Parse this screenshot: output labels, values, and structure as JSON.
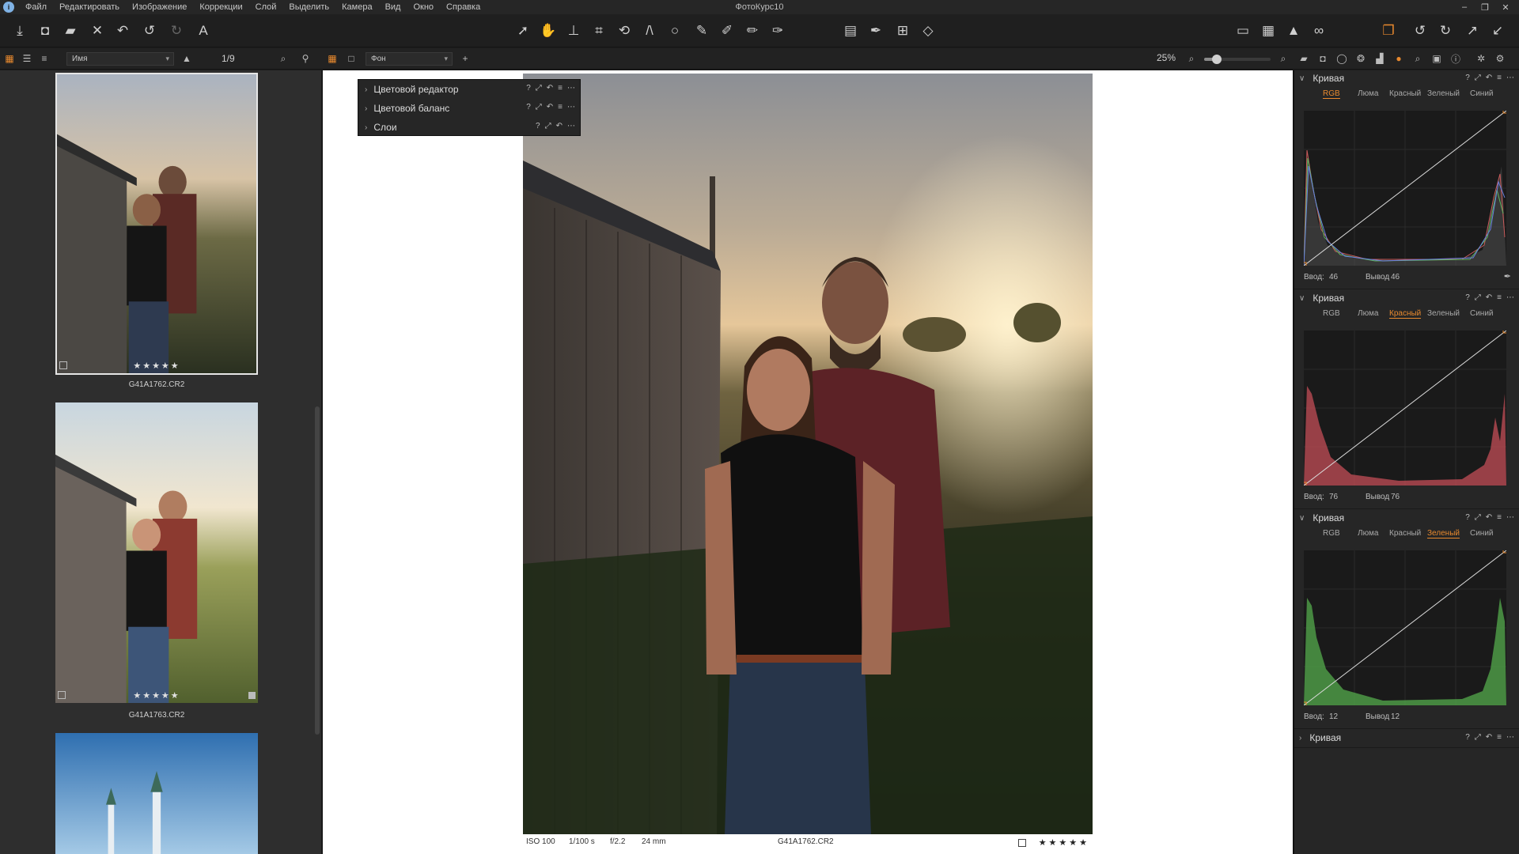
{
  "app": {
    "title": "ФотоКурс10",
    "menu": [
      "Файл",
      "Редактировать",
      "Изображение",
      "Коррекции",
      "Слой",
      "Выделить",
      "Камера",
      "Вид",
      "Окно",
      "Справка"
    ],
    "window_controls": [
      "–",
      "❐",
      "✕"
    ]
  },
  "toolbar": {
    "left_icons": [
      "import-icon",
      "camera-icon",
      "folder-export-icon",
      "delete-icon",
      "undo-icon",
      "undo-step-icon",
      "redo-icon",
      "text-icon"
    ],
    "center_icons": [
      "cursor-icon",
      "hand-icon",
      "stamp-icon",
      "crop-icon",
      "rotate-icon",
      "straighten-icon",
      "circle-icon",
      "brush-icon",
      "pen-icon",
      "eraser-icon",
      "gradient-icon"
    ],
    "right_icons": [
      "layout-icon",
      "eyedropper-icon",
      "grid-icon",
      "warning-icon",
      "proof-icon",
      "workspace-icon",
      "rotate-left-icon",
      "rotate-right-icon",
      "export-icon",
      "import-arrow-icon"
    ]
  },
  "subbar": {
    "sort_select": "Имя",
    "counter": "1/9",
    "layer_select": "Фон",
    "zoom": "25%"
  },
  "browser": {
    "thumbnails": [
      {
        "name": "G41A1762.CR2",
        "stars": "★★★★★",
        "selected": true
      },
      {
        "name": "G41A1763.CR2",
        "stars": "★★★★★",
        "selected": false
      },
      {
        "name": "",
        "stars": "",
        "selected": false
      }
    ]
  },
  "viewer": {
    "info": {
      "iso": "ISO 100",
      "shutter": "1/100 s",
      "aperture": "f/2.2",
      "focal": "24 mm",
      "filename": "G41A1762.CR2",
      "stars": "★★★★★"
    }
  },
  "popup": {
    "rows": [
      {
        "label": "Цветовой редактор"
      },
      {
        "label": "Цветовой баланс"
      },
      {
        "label": "Слои"
      }
    ]
  },
  "right_panel": {
    "tabs": [
      "RGB",
      "Люма",
      "Красный",
      "Зеленый",
      "Синий"
    ],
    "curves": [
      {
        "title": "Кривая",
        "active_tab": 0,
        "input_label": "Ввод:",
        "input": "46",
        "output_label": "Вывод",
        "output": "46",
        "color": "#8a8a8a"
      },
      {
        "title": "Кривая",
        "active_tab": 2,
        "input_label": "Ввод:",
        "input": "76",
        "output_label": "Вывод",
        "output": "76",
        "color": "#b84a52"
      },
      {
        "title": "Кривая",
        "active_tab": 3,
        "input_label": "Ввод:",
        "input": "12",
        "output_label": "Вывод",
        "output": "12",
        "color": "#4e9a46"
      },
      {
        "title": "Кривая",
        "collapsed": true
      }
    ]
  },
  "colors": {
    "accent": "#e8892e",
    "panel": "#262626",
    "viewer_bg": "#ffffff"
  }
}
